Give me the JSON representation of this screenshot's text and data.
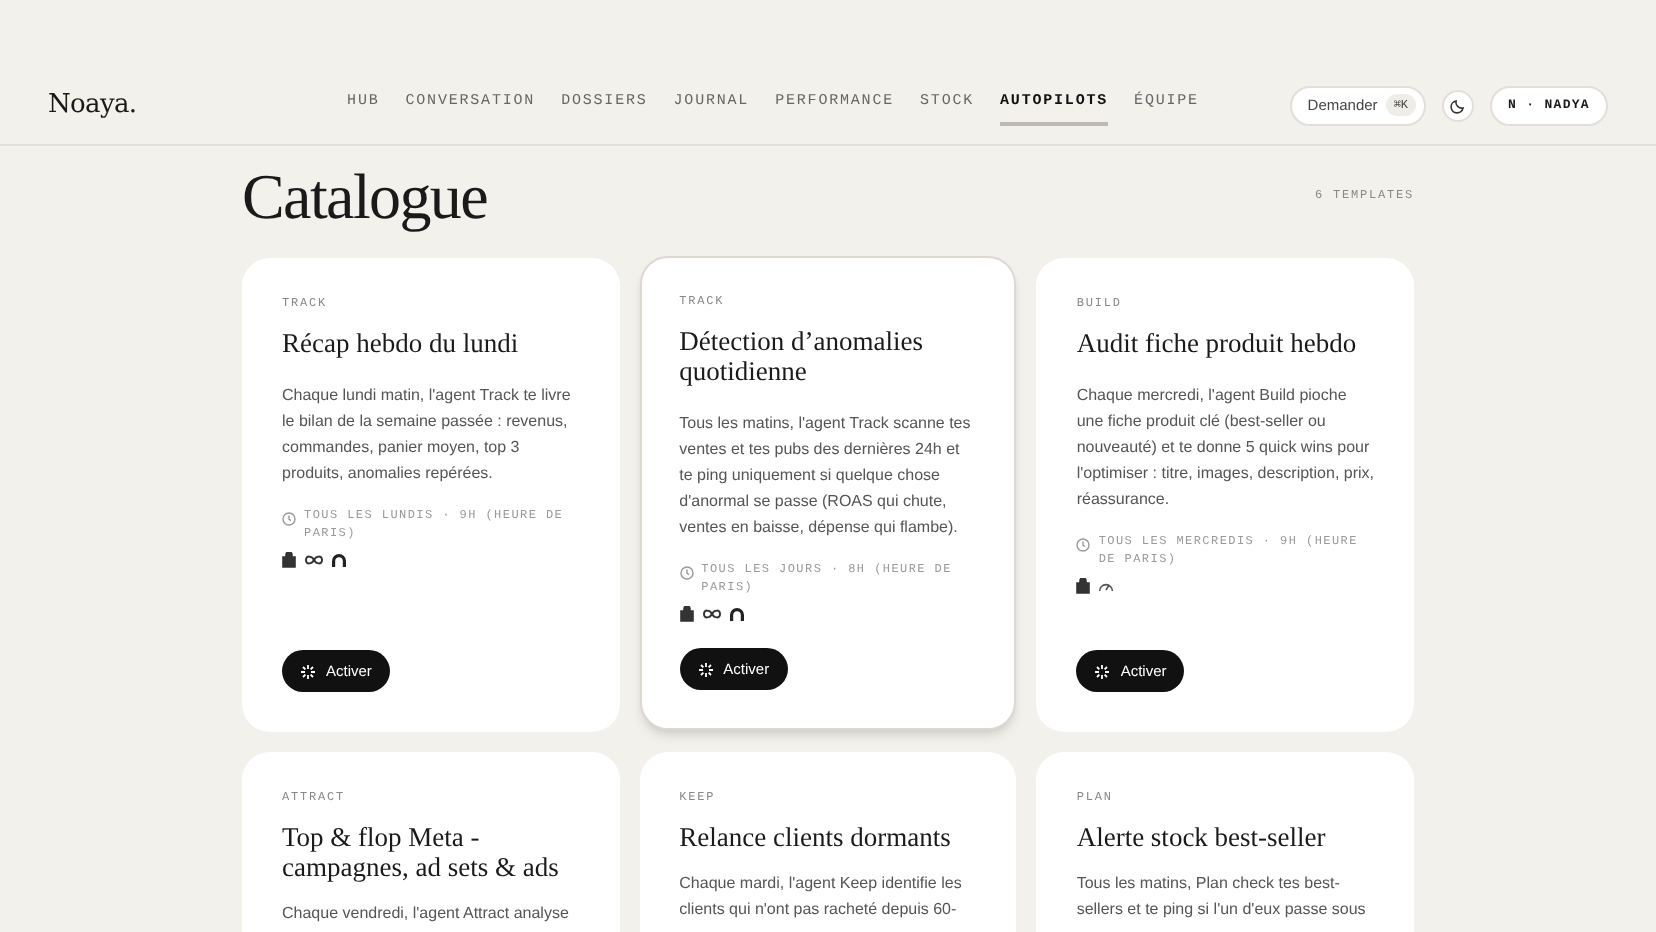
{
  "header": {
    "logo": "Noaya.",
    "nav": [
      {
        "label": "HUB",
        "selected": false
      },
      {
        "label": "CONVERSATION",
        "selected": false
      },
      {
        "label": "DOSSIERS",
        "selected": false
      },
      {
        "label": "JOURNAL",
        "selected": false
      },
      {
        "label": "PERFORMANCE",
        "selected": false
      },
      {
        "label": "STOCK",
        "selected": false
      },
      {
        "label": "AUTOPILOTS",
        "selected": true
      },
      {
        "label": "ÉQUIPE",
        "selected": false
      }
    ],
    "ask_button": {
      "label": "Demander",
      "shortcut": "⌘K"
    },
    "user_button": "N · NADYA"
  },
  "page": {
    "title": "Catalogue",
    "count": "6 TEMPLATES"
  },
  "cards": [
    {
      "agent": "TRACK",
      "title": "Récap hebdo du lundi",
      "description": "Chaque lundi matin, l'agent Track te livre le bilan de la semaine passée : revenus, commandes, panier moyen, top 3 produits, anomalies repérées.",
      "schedule": "TOUS LES LUNDIS · 9H (HEURE DE PARIS)",
      "integrations": [
        {
          "kind": "bag"
        },
        {
          "kind": "infinity"
        },
        {
          "kind": "arch"
        }
      ],
      "button": "Activer",
      "highlighted": false
    },
    {
      "agent": "TRACK",
      "title": "Détection d’anomalies quotidienne",
      "description": "Tous les matins, l'agent Track scanne tes ventes et tes pubs des dernières 24h et te ping uniquement si quelque chose d'anormal se passe (ROAS qui chute, ventes en baisse, dépense qui flambe).",
      "schedule": "TOUS LES JOURS · 8H (HEURE DE PARIS)",
      "integrations": [
        {
          "kind": "bag"
        },
        {
          "kind": "infinity"
        },
        {
          "kind": "arch"
        }
      ],
      "button": "Activer",
      "highlighted": true
    },
    {
      "agent": "BUILD",
      "title": "Audit fiche produit hebdo",
      "description": "Chaque mercredi, l'agent Build pioche une fiche produit clé (best-seller ou nouveauté) et te donne 5 quick wins pour l'optimiser : titre, images, description, prix, réassurance.",
      "schedule": "TOUS LES MERCREDIS · 9H (HEURE DE PARIS)",
      "integrations": [
        {
          "kind": "bag"
        },
        {
          "kind": "gauge"
        }
      ],
      "button": "Activer",
      "highlighted": false
    },
    {
      "agent": "ATTRACT",
      "title": "Top & flop Meta - campagnes, ad sets & ads",
      "description": "Chaque vendredi, l'agent Attract analyse",
      "highlighted": false
    },
    {
      "agent": "KEEP",
      "title": "Relance clients dormants",
      "description": "Chaque mardi, l'agent Keep identifie les clients qui n'ont pas racheté depuis 60-",
      "highlighted": false
    },
    {
      "agent": "PLAN",
      "title": "Alerte stock best-seller",
      "description": "Tous les matins, Plan check tes best-sellers et te ping si l'un d'eux passe sous",
      "highlighted": false
    }
  ]
}
